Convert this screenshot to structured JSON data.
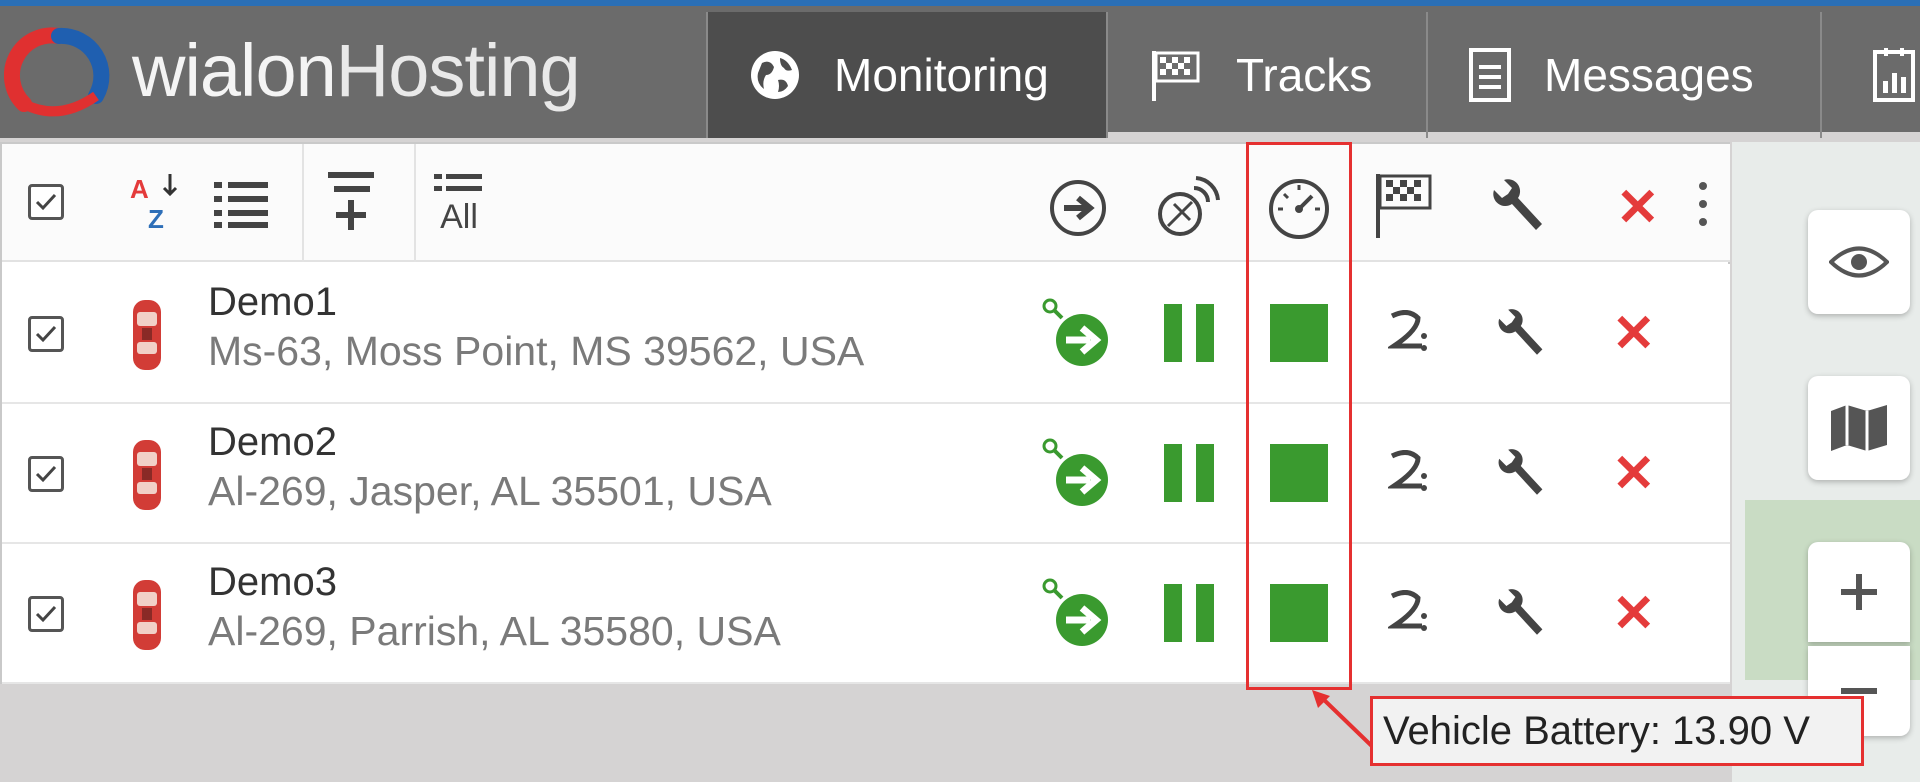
{
  "app": {
    "logo_text": "wialon",
    "logo_text_thin": "Hosting"
  },
  "tabs": [
    {
      "label": "Monitoring",
      "icon": "globe-icon"
    },
    {
      "label": "Tracks",
      "icon": "checkered-flag-icon"
    },
    {
      "label": "Messages",
      "icon": "messages-icon"
    },
    {
      "label": "",
      "icon": "reports-icon"
    }
  ],
  "toolbar": {
    "show_all_label": "All"
  },
  "units": [
    {
      "name": "Demo1",
      "address": "Ms-63, Moss Point, MS 39562, USA"
    },
    {
      "name": "Demo2",
      "address": "Al-269, Jasper, AL 35501, USA"
    },
    {
      "name": "Demo3",
      "address": "Al-269, Parrish, AL 35580, USA"
    }
  ],
  "tooltip": {
    "text": "Vehicle Battery: 13.90 V"
  },
  "colors": {
    "accent_blue": "#2a6fb6",
    "sensor_green": "#3a9a2f",
    "delete_red": "#e43b3b",
    "highlight_red": "#e53030"
  }
}
